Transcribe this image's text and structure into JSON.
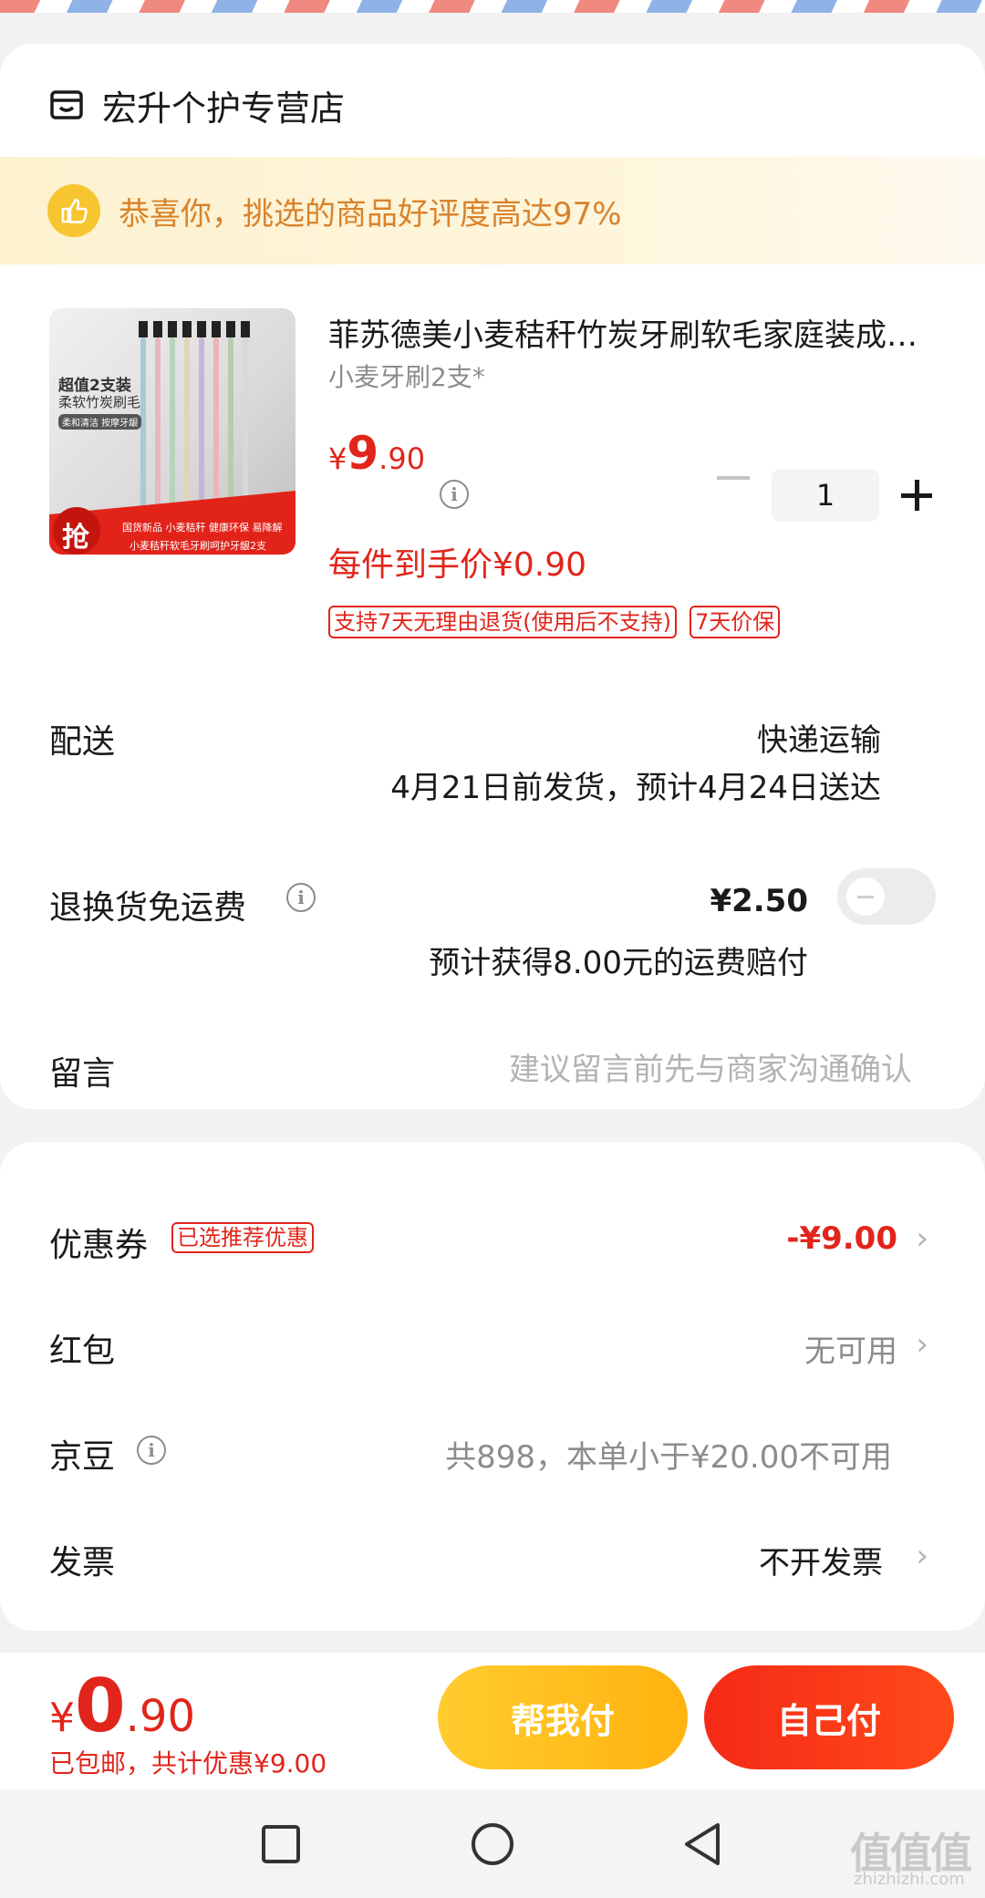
{
  "store": {
    "name": "宏升个护专营店",
    "icon": "store-icon"
  },
  "banner": {
    "text": "恭喜你，挑选的商品好评度高达97%",
    "icon": "thumbs-up-icon"
  },
  "product": {
    "title": "菲苏德美小麦秸秆竹炭牙刷软毛家庭装成人牙刷",
    "spec": "小麦牙刷2支*",
    "price_currency": "¥",
    "price_int": "9",
    "price_dec": ".90",
    "unit_price": "每件到手价¥0.90",
    "quantity": "1",
    "tags": [
      "支持7天无理由退货(使用后不支持)",
      "7天价保"
    ],
    "image": {
      "badge_top": "超值2支装",
      "badge_sub": "柔软竹炭刷毛",
      "badge_small": "柔和清洁 按摩牙龈",
      "grab": "抢",
      "features": "国货新品 小麦秸秆 健康环保 易降解",
      "caption": "小麦秸秆软毛牙刷呵护牙龈2支"
    }
  },
  "delivery": {
    "label": "配送",
    "mode": "快递运输",
    "date": "4月21日前发货，预计4月24日送达"
  },
  "return_shipping": {
    "label": "退换货免运费",
    "price": "¥2.50",
    "note": "预计获得8.00元的运费赔付",
    "enabled": false
  },
  "message": {
    "label": "留言",
    "placeholder": "建议留言前先与商家沟通确认"
  },
  "discounts": {
    "coupon": {
      "label": "优惠券",
      "tag": "已选推荐优惠",
      "value": "-¥9.00"
    },
    "redpacket": {
      "label": "红包",
      "value": "无可用"
    },
    "jingdou": {
      "label": "京豆",
      "value": "共898，本单小于¥20.00不可用"
    },
    "invoice": {
      "label": "发票",
      "value": "不开发票"
    }
  },
  "footer": {
    "total_currency": "¥",
    "total_int": "0",
    "total_dec": ".90",
    "shipping_note": "已包邮，共计优惠¥9.00",
    "help_pay": "帮我付",
    "self_pay": "自己付"
  },
  "watermark": {
    "text": "值值值",
    "url": "zhizhizhi.com"
  },
  "colors": {
    "accent": "#e1251b",
    "gold": "#ffb30f",
    "banner_text": "#d9822b"
  }
}
